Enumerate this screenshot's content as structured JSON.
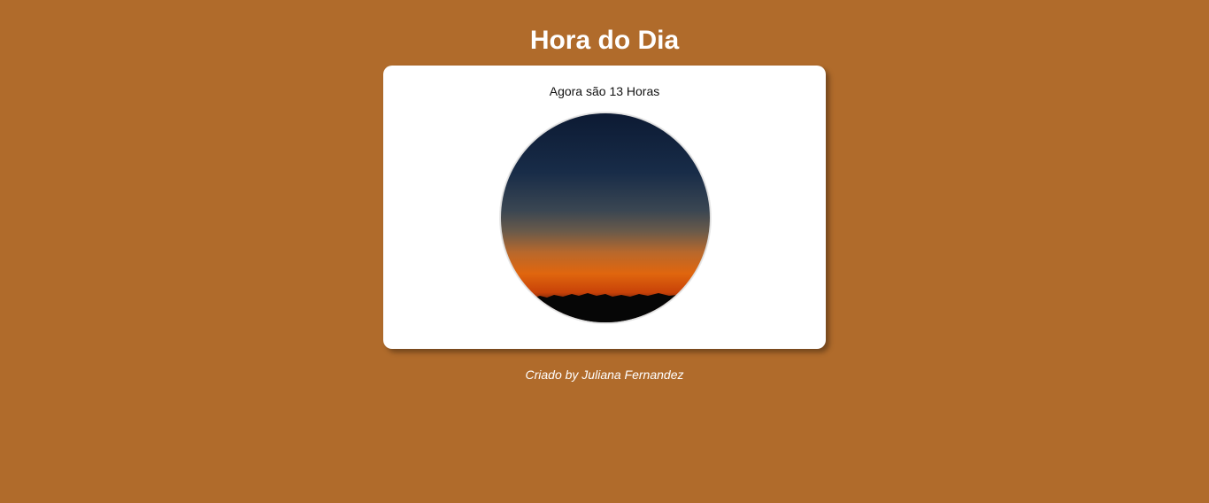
{
  "header": {
    "title": "Hora do Dia"
  },
  "card": {
    "hour_text": "Agora são 13 Horas",
    "image": "sunset-sky-photo"
  },
  "footer": {
    "credit": "Criado by Juliana Fernandez"
  },
  "colors": {
    "background": "#b06b2b",
    "card": "#ffffff",
    "text_light": "#ffffff",
    "text_dark": "#111111"
  }
}
